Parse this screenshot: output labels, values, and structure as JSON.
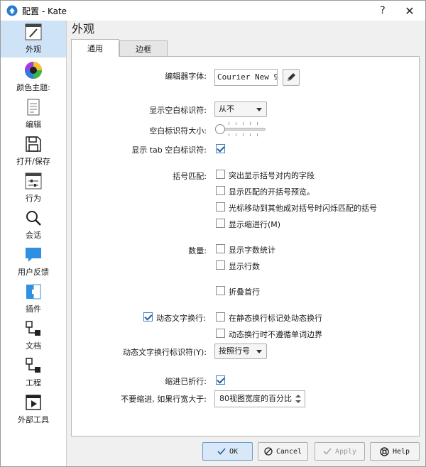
{
  "window": {
    "title": "配置 - Kate",
    "help_glyph": "?",
    "close_glyph": "✕"
  },
  "sidebar": {
    "items": [
      {
        "label": "外观",
        "icon": "brush-icon",
        "active": true
      },
      {
        "label": "颜色主题:",
        "icon": "color-wheel-icon"
      },
      {
        "label": "编辑",
        "icon": "document-edit-icon"
      },
      {
        "label": "打开/保存",
        "icon": "floppy-disk-icon"
      },
      {
        "label": "行为",
        "icon": "behavior-sliders-icon"
      },
      {
        "label": "会话",
        "icon": "magnifier-icon"
      },
      {
        "label": "用户反馈",
        "icon": "chat-bubble-icon"
      },
      {
        "label": "插件",
        "icon": "plugin-icon"
      },
      {
        "label": "文档",
        "icon": "tree-nodes-icon"
      },
      {
        "label": "工程",
        "icon": "project-nodes-icon"
      },
      {
        "label": "外部工具",
        "icon": "run-tool-icon"
      }
    ]
  },
  "main": {
    "title": "外观",
    "tabs": [
      {
        "label": "通用",
        "active": true
      },
      {
        "label": "边框",
        "active": false
      }
    ]
  },
  "form": {
    "font_label": "编辑器字体:",
    "font_value": "Courier New 9",
    "show_whitespace_label": "显示空白标识符:",
    "show_whitespace_value": "从不",
    "whitespace_size_label": "空白标识符大小:",
    "show_tabs_label": "显示 tab 空白标识符:",
    "show_tabs_checked": true,
    "bracket_label": "括号匹配:",
    "bracket_options": [
      {
        "label": "突出显示括号对内的字段",
        "checked": false
      },
      {
        "label": "显示匹配的开括号预览。",
        "checked": false
      },
      {
        "label": "光标移动到其他成对括号时闪烁匹配的括号",
        "checked": false
      },
      {
        "label": "显示缩进行(M)",
        "checked": false
      }
    ],
    "counts_label": "数量:",
    "counts_options": [
      {
        "label": "显示字数统计",
        "checked": false
      },
      {
        "label": "显示行数",
        "checked": false
      }
    ],
    "fold_first_line_label": "折叠首行",
    "fold_first_line_checked": false,
    "dynamic_wrap_label": "动态文字换行:",
    "dynamic_wrap_checked": true,
    "dynamic_wrap_options": [
      {
        "label": "在静态换行标记处动态换行",
        "checked": false
      },
      {
        "label": "动态换行时不遵循单词边界",
        "checked": false
      }
    ],
    "wrap_indicator_label": "动态文字换行标识符(Y):",
    "wrap_indicator_value": "按照行号",
    "indent_wrapped_label": "缩进已折行:",
    "indent_wrapped_checked": true,
    "no_indent_label": "不要缩进, 如果行宽大于:",
    "no_indent_value": "80视图宽度的百分比"
  },
  "buttons": {
    "ok": "OK",
    "cancel": "Cancel",
    "apply": "Apply",
    "help": "Help"
  },
  "colors": {
    "accent": "#1f5fa8",
    "selection": "#cfe3f7"
  }
}
